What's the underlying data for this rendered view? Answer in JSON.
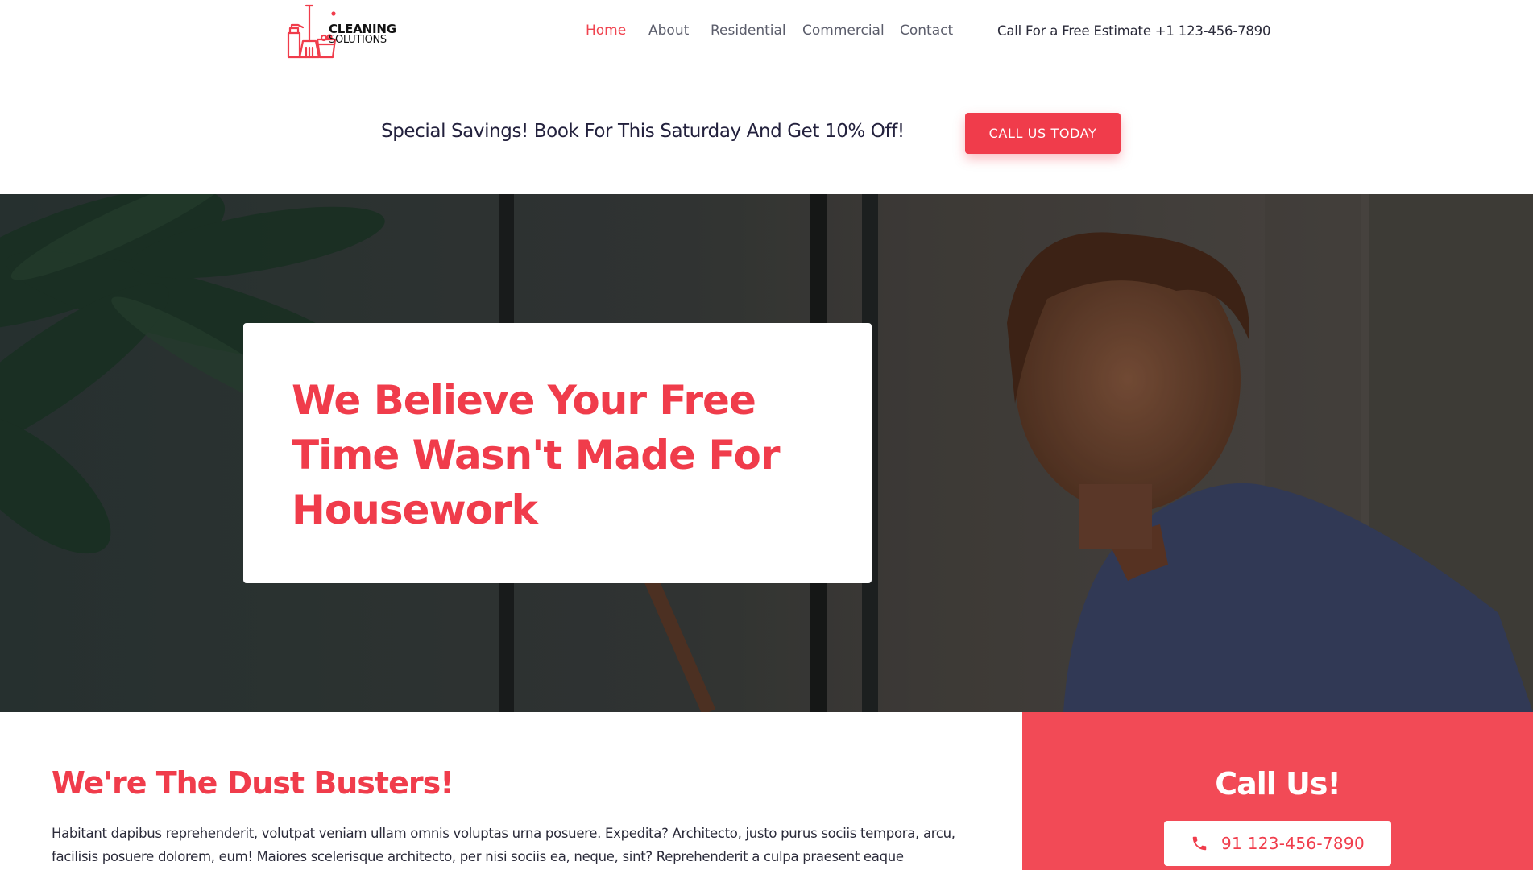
{
  "brand": {
    "name_line1": "CLEANING",
    "name_line2": "SOLUTIONS",
    "accent_color": "#f03c4b"
  },
  "nav": {
    "items": [
      {
        "label": "Home",
        "active": true
      },
      {
        "label": "About",
        "active": false
      },
      {
        "label": "Residential",
        "active": false
      },
      {
        "label": "Commercial",
        "active": false
      },
      {
        "label": "Contact",
        "active": false
      }
    ]
  },
  "header": {
    "estimate_text": "Call For a Free Estimate +1 123-456-7890"
  },
  "promo": {
    "text": "Special Savings! Book For This Saturday And Get 10% Off!",
    "button_label": "CALL US TODAY"
  },
  "hero": {
    "title": "We Believe Your Free Time Wasn't Made For Housework"
  },
  "about": {
    "heading": "We're The Dust Busters!",
    "body": "Habitant dapibus reprehenderit, volutpat veniam ullam omnis voluptas urna posuere. Expedita? Architecto, justo purus sociis tempora, arcu, facilisis posuere dolorem, eum! Maiores scelerisque architecto, per nisi sociis ea, neque, sint? Reprehenderit a culpa praesent eaque placerat."
  },
  "callus": {
    "heading": "Call Us!",
    "phone": "91 123-456-7890",
    "icon": "phone-icon"
  }
}
